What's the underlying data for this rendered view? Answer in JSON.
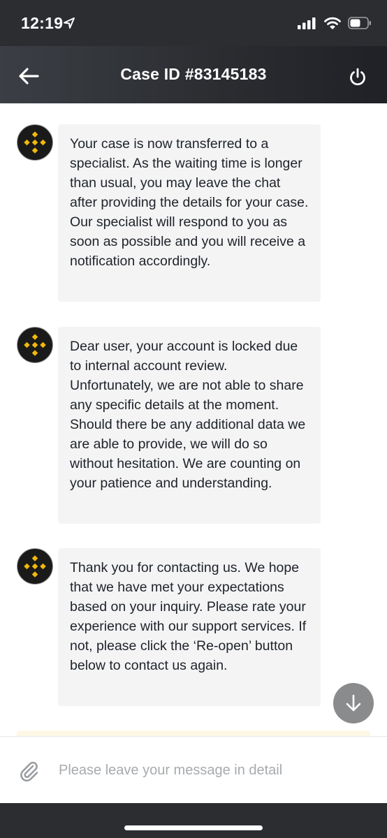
{
  "status_bar": {
    "time": "12:19"
  },
  "header": {
    "title": "Case ID #83145183"
  },
  "messages": [
    {
      "text": "Your case is now transferred to a specialist. As the waiting time is longer than usual, you may leave the chat after providing the details for your case. Our specialist will respond to you as soon as possible and you will receive a notification accordingly."
    },
    {
      "text": "Dear user, your account is locked due to internal account review. Unfortunately, we are not able to share any specific details at the moment. Should there be any additional data we are able to provide, we will do so without hesitation. We are counting on your patience and understanding."
    },
    {
      "text": "Thank you for contacting us. We hope that we have met your expectations based on your inquiry. Please rate your experience with our support services. If not, please click the ‘Re-open’ button below to contact us again."
    }
  ],
  "composer": {
    "placeholder": "Please leave your message in detail"
  },
  "icons": {
    "back": "arrow-left-icon",
    "power": "power-icon",
    "avatar": "binance-logo-icon",
    "scroll": "arrow-down-icon",
    "attach": "paperclip-icon"
  },
  "colors": {
    "header_bg": "#2b2d31",
    "bubble_bg": "#f4f4f5",
    "brand_gold": "#f0b90b",
    "scroll_btn": "#8a8b8d"
  }
}
